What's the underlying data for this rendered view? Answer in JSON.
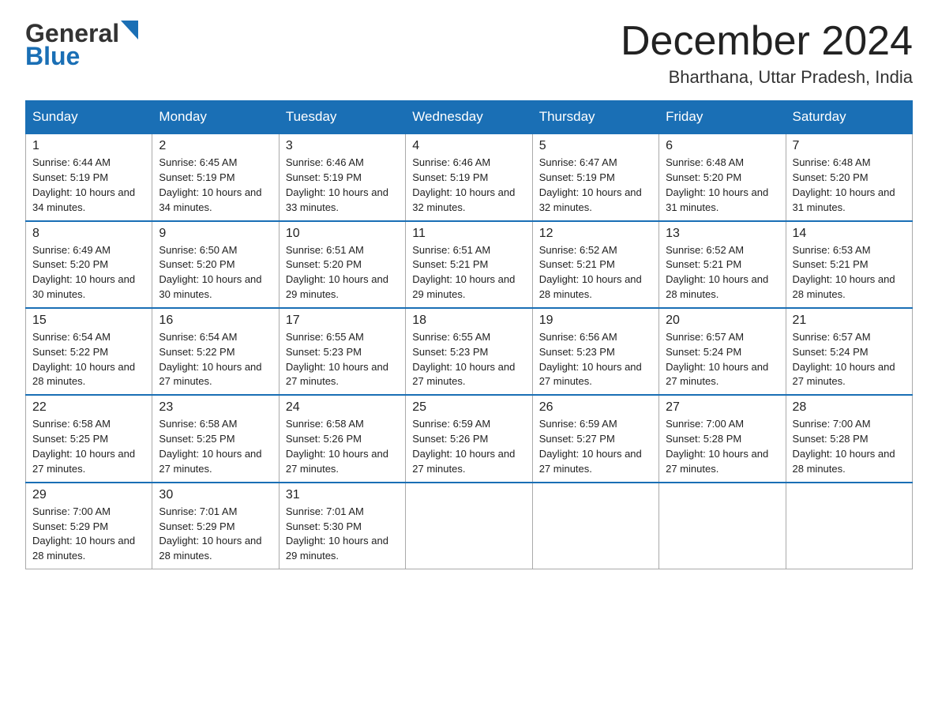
{
  "logo": {
    "general_text": "General",
    "blue_text": "Blue"
  },
  "header": {
    "month_title": "December 2024",
    "location": "Bharthana, Uttar Pradesh, India"
  },
  "days_of_week": [
    "Sunday",
    "Monday",
    "Tuesday",
    "Wednesday",
    "Thursday",
    "Friday",
    "Saturday"
  ],
  "weeks": [
    [
      {
        "day": "1",
        "sunrise": "6:44 AM",
        "sunset": "5:19 PM",
        "daylight": "10 hours and 34 minutes."
      },
      {
        "day": "2",
        "sunrise": "6:45 AM",
        "sunset": "5:19 PM",
        "daylight": "10 hours and 34 minutes."
      },
      {
        "day": "3",
        "sunrise": "6:46 AM",
        "sunset": "5:19 PM",
        "daylight": "10 hours and 33 minutes."
      },
      {
        "day": "4",
        "sunrise": "6:46 AM",
        "sunset": "5:19 PM",
        "daylight": "10 hours and 32 minutes."
      },
      {
        "day": "5",
        "sunrise": "6:47 AM",
        "sunset": "5:19 PM",
        "daylight": "10 hours and 32 minutes."
      },
      {
        "day": "6",
        "sunrise": "6:48 AM",
        "sunset": "5:20 PM",
        "daylight": "10 hours and 31 minutes."
      },
      {
        "day": "7",
        "sunrise": "6:48 AM",
        "sunset": "5:20 PM",
        "daylight": "10 hours and 31 minutes."
      }
    ],
    [
      {
        "day": "8",
        "sunrise": "6:49 AM",
        "sunset": "5:20 PM",
        "daylight": "10 hours and 30 minutes."
      },
      {
        "day": "9",
        "sunrise": "6:50 AM",
        "sunset": "5:20 PM",
        "daylight": "10 hours and 30 minutes."
      },
      {
        "day": "10",
        "sunrise": "6:51 AM",
        "sunset": "5:20 PM",
        "daylight": "10 hours and 29 minutes."
      },
      {
        "day": "11",
        "sunrise": "6:51 AM",
        "sunset": "5:21 PM",
        "daylight": "10 hours and 29 minutes."
      },
      {
        "day": "12",
        "sunrise": "6:52 AM",
        "sunset": "5:21 PM",
        "daylight": "10 hours and 28 minutes."
      },
      {
        "day": "13",
        "sunrise": "6:52 AM",
        "sunset": "5:21 PM",
        "daylight": "10 hours and 28 minutes."
      },
      {
        "day": "14",
        "sunrise": "6:53 AM",
        "sunset": "5:21 PM",
        "daylight": "10 hours and 28 minutes."
      }
    ],
    [
      {
        "day": "15",
        "sunrise": "6:54 AM",
        "sunset": "5:22 PM",
        "daylight": "10 hours and 28 minutes."
      },
      {
        "day": "16",
        "sunrise": "6:54 AM",
        "sunset": "5:22 PM",
        "daylight": "10 hours and 27 minutes."
      },
      {
        "day": "17",
        "sunrise": "6:55 AM",
        "sunset": "5:23 PM",
        "daylight": "10 hours and 27 minutes."
      },
      {
        "day": "18",
        "sunrise": "6:55 AM",
        "sunset": "5:23 PM",
        "daylight": "10 hours and 27 minutes."
      },
      {
        "day": "19",
        "sunrise": "6:56 AM",
        "sunset": "5:23 PM",
        "daylight": "10 hours and 27 minutes."
      },
      {
        "day": "20",
        "sunrise": "6:57 AM",
        "sunset": "5:24 PM",
        "daylight": "10 hours and 27 minutes."
      },
      {
        "day": "21",
        "sunrise": "6:57 AM",
        "sunset": "5:24 PM",
        "daylight": "10 hours and 27 minutes."
      }
    ],
    [
      {
        "day": "22",
        "sunrise": "6:58 AM",
        "sunset": "5:25 PM",
        "daylight": "10 hours and 27 minutes."
      },
      {
        "day": "23",
        "sunrise": "6:58 AM",
        "sunset": "5:25 PM",
        "daylight": "10 hours and 27 minutes."
      },
      {
        "day": "24",
        "sunrise": "6:58 AM",
        "sunset": "5:26 PM",
        "daylight": "10 hours and 27 minutes."
      },
      {
        "day": "25",
        "sunrise": "6:59 AM",
        "sunset": "5:26 PM",
        "daylight": "10 hours and 27 minutes."
      },
      {
        "day": "26",
        "sunrise": "6:59 AM",
        "sunset": "5:27 PM",
        "daylight": "10 hours and 27 minutes."
      },
      {
        "day": "27",
        "sunrise": "7:00 AM",
        "sunset": "5:28 PM",
        "daylight": "10 hours and 27 minutes."
      },
      {
        "day": "28",
        "sunrise": "7:00 AM",
        "sunset": "5:28 PM",
        "daylight": "10 hours and 28 minutes."
      }
    ],
    [
      {
        "day": "29",
        "sunrise": "7:00 AM",
        "sunset": "5:29 PM",
        "daylight": "10 hours and 28 minutes."
      },
      {
        "day": "30",
        "sunrise": "7:01 AM",
        "sunset": "5:29 PM",
        "daylight": "10 hours and 28 minutes."
      },
      {
        "day": "31",
        "sunrise": "7:01 AM",
        "sunset": "5:30 PM",
        "daylight": "10 hours and 29 minutes."
      },
      null,
      null,
      null,
      null
    ]
  ],
  "labels": {
    "sunrise_prefix": "Sunrise: ",
    "sunset_prefix": "Sunset: ",
    "daylight_prefix": "Daylight: "
  }
}
